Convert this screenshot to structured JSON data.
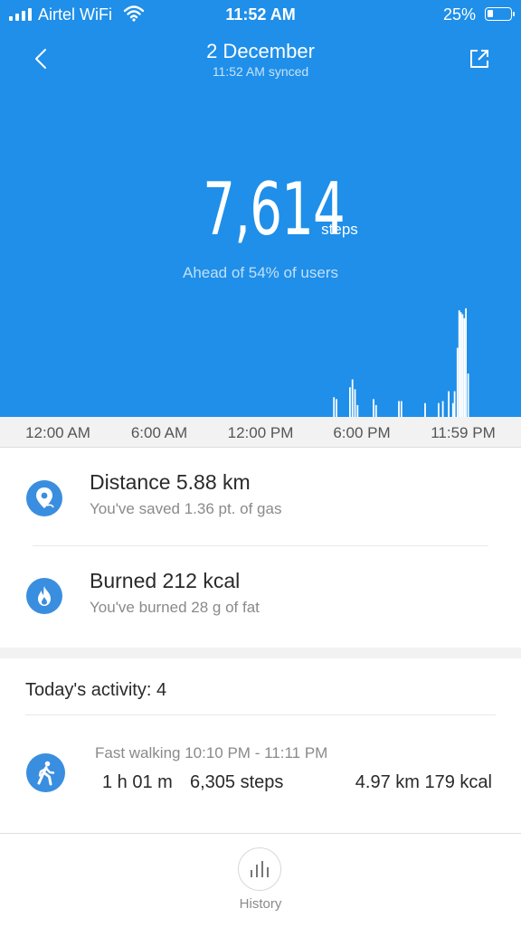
{
  "status_bar": {
    "carrier": "Airtel WiFi",
    "time": "11:52 AM",
    "battery": "25%"
  },
  "header": {
    "title": "2 December",
    "subtitle": "11:52 AM synced"
  },
  "summary": {
    "steps": "7,614",
    "steps_unit": "steps",
    "rank_text": "Ahead of 54% of users"
  },
  "chart_data": {
    "type": "bar",
    "x_tick_labels": [
      "12:00 AM",
      "6:00 AM",
      "12:00 PM",
      "6:00 PM",
      "11:59 PM"
    ],
    "x_ticks_hours": [
      0,
      6,
      12,
      18,
      24
    ],
    "x_range_hours": [
      0,
      24
    ],
    "bar_color": "#ffffff",
    "bars": [
      {
        "hour": 16.3,
        "value": 20
      },
      {
        "hour": 16.45,
        "value": 18
      },
      {
        "hour": 17.25,
        "value": 30
      },
      {
        "hour": 17.4,
        "value": 38
      },
      {
        "hour": 17.55,
        "value": 28
      },
      {
        "hour": 17.7,
        "value": 12
      },
      {
        "hour": 18.65,
        "value": 18
      },
      {
        "hour": 18.8,
        "value": 12
      },
      {
        "hour": 20.15,
        "value": 16
      },
      {
        "hour": 20.3,
        "value": 16
      },
      {
        "hour": 21.7,
        "value": 14
      },
      {
        "hour": 22.5,
        "value": 14
      },
      {
        "hour": 22.75,
        "value": 16
      },
      {
        "hour": 23.1,
        "value": 26
      },
      {
        "hour": 23.35,
        "value": 14
      },
      {
        "hour": 23.45,
        "value": 26
      },
      {
        "hour": 23.62,
        "value": 70
      },
      {
        "hour": 23.72,
        "value": 108
      },
      {
        "hour": 23.82,
        "value": 106
      },
      {
        "hour": 23.92,
        "value": 104
      },
      {
        "hour": 24.02,
        "value": 100
      },
      {
        "hour": 24.12,
        "value": 110
      },
      {
        "hour": 24.25,
        "value": 44
      }
    ]
  },
  "stats": [
    {
      "icon": "location-pin-icon",
      "main": "Distance  5.88 km",
      "sub": "You've saved 1.36 pt. of gas"
    },
    {
      "icon": "flame-icon",
      "main": "Burned  212 kcal",
      "sub": "You've burned 28 g of fat"
    }
  ],
  "activity": {
    "header": "Today's activity: 4",
    "item": {
      "title": "Fast walking 10:10 PM - 11:11 PM",
      "duration": "1 h 01 m",
      "steps": "6,305 steps",
      "distance_kcal": "4.97 km 179 kcal"
    }
  },
  "tabbar": {
    "history_label": "History"
  },
  "colors": {
    "primary": "#1f8fe9",
    "icon_bg": "#3a8ee0"
  }
}
